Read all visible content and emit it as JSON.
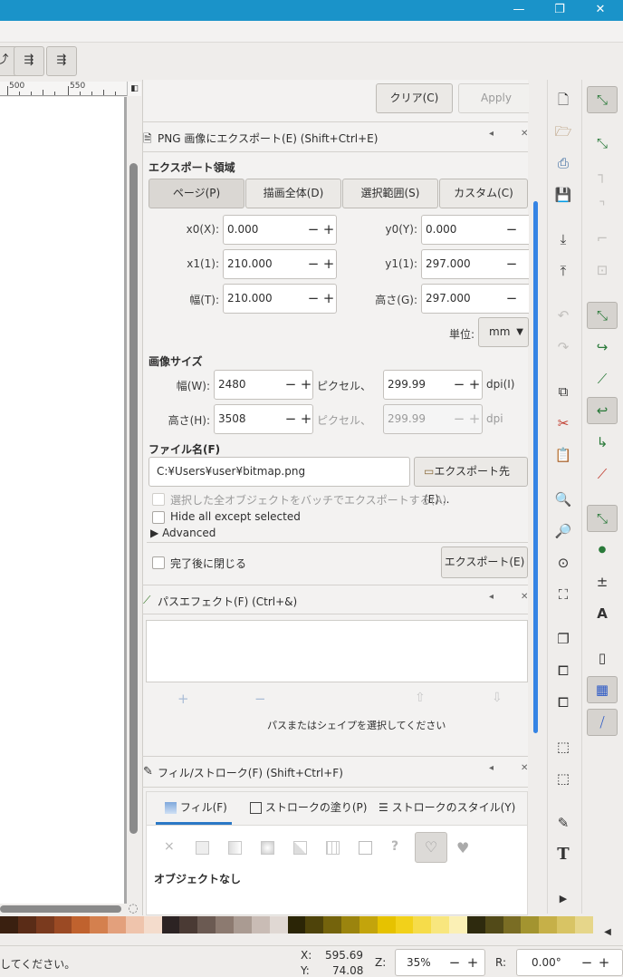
{
  "window": {
    "minimize": "—",
    "maximize": "❐",
    "close": "✕"
  },
  "toolbar": {
    "btn1": "⤴",
    "btn2": "⇶",
    "btn3": "⇶"
  },
  "ruler": {
    "label_500": "500",
    "label_550": "550"
  },
  "dock": {
    "clear_label": "クリア(C)",
    "apply_label": "Apply",
    "export_title": "PNG 画像にエクスポート(E) (Shift+Ctrl+E)",
    "export_area_label": "エクスポート領域",
    "tabs": [
      "ページ(P)",
      "描画全体(D)",
      "選択範囲(S)",
      "カスタム(C)"
    ],
    "x0_label": "x0(X):",
    "x0_value": "0.000",
    "y0_label": "y0(Y):",
    "y0_value": "0.000",
    "x1_label": "x1(1):",
    "x1_value": "210.000",
    "y1_label": "y1(1):",
    "y1_value": "297.000",
    "width_label": "幅(T):",
    "width_value": "210.000",
    "height_label": "高さ(G):",
    "height_value": "297.000",
    "unit_label": "単位:",
    "unit_value": "mm",
    "image_size_label": "画像サイズ",
    "img_width_label": "幅(W):",
    "img_width_value": "2480",
    "pixels_1": "ピクセル、",
    "dpi_value": "299.99",
    "dpi_label": "dpi(I)",
    "img_height_label": "高さ(H):",
    "img_height_value": "3508",
    "pixels_2": "ピクセル、",
    "dpi2_value": "299.99",
    "dpi2_label": "dpi",
    "filename_label": "ファイル名(F)",
    "filename_value": "C:¥Users¥user¥bitmap.png",
    "export_as_label": "エクスポート先(E)...",
    "batch_label": "選択した全オブジェクトをバッチでエクスポートする(A)",
    "hide_label": "Hide all except selected",
    "advanced_label": "Advanced",
    "close_after_label": "完了後に閉じる",
    "export_button": "エクスポート(E)",
    "path_effects_title": "パスエフェクト(F) (Ctrl+&)",
    "path_hint": "パスまたはシェイプを選択してください",
    "fill_stroke_title": "フィル/ストローク(F) (Shift+Ctrl+F)",
    "fill_tab": "フィル(F)",
    "stroke_paint_tab": "ストロークの塗り(P)",
    "stroke_style_tab": "ストロークのスタイル(Y)",
    "no_object": "オブジェクトなし",
    "paint_none": "×",
    "paint_unknown": "?"
  },
  "palette": [
    "#3a2010",
    "#5a2c17",
    "#7a3a1e",
    "#9b4a24",
    "#c0622e",
    "#d4804e",
    "#e3a07c",
    "#efc4ac",
    "#f4dccc",
    "#2c2323",
    "#4a3a34",
    "#6b5a52",
    "#8c7a70",
    "#aa9b92",
    "#c9bcb5",
    "#e0d8d3",
    "#2b2506",
    "#4e430a",
    "#74630c",
    "#9b840e",
    "#c3a40c",
    "#e6c200",
    "#f2d11a",
    "#f6dc4a",
    "#f8e67e",
    "#fbf0b5",
    "#2e2a0e",
    "#524a18",
    "#7a6d24",
    "#a39430",
    "#c6b048",
    "#d8c464",
    "#e6d68a"
  ],
  "status": {
    "message": "してください。",
    "x_label": "X:",
    "x_value": "595.69",
    "y_label": "Y:",
    "y_value": "74.08",
    "zoom_label": "Z:",
    "zoom_value": "35%",
    "rotate_label": "R:",
    "rotate_value": "0.00°"
  }
}
